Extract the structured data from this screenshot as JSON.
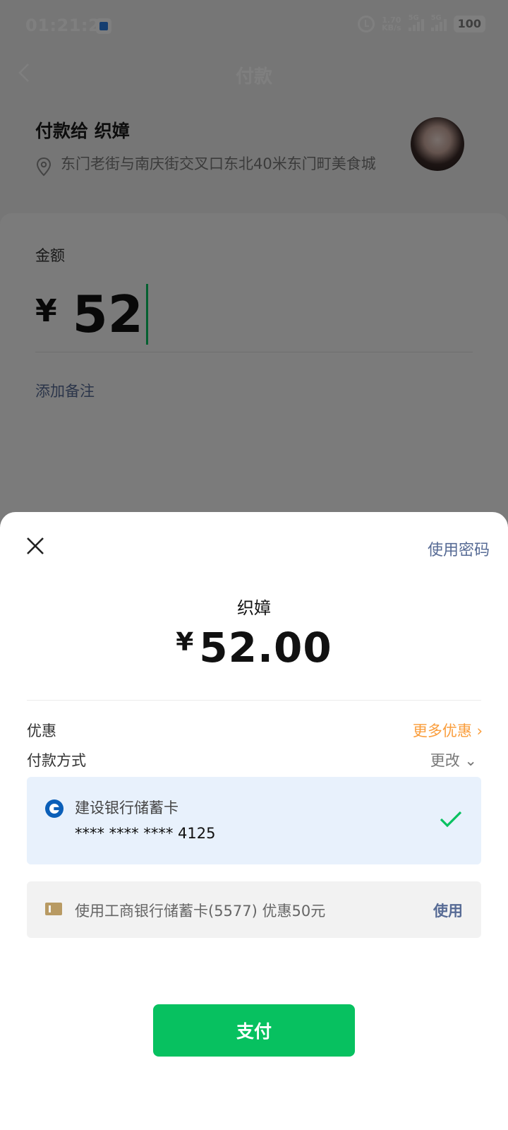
{
  "status_bar": {
    "time": "01:21:26",
    "net_speed_value": "1.70",
    "net_speed_unit": "KB/s",
    "sim1": "5G",
    "sim2": "5G",
    "battery": "100"
  },
  "nav": {
    "title": "付款"
  },
  "payee": {
    "title": "付款给 织嫜",
    "location": "东门老街与南庆街交叉口东北40米东门町美食城"
  },
  "amount": {
    "label": "金额",
    "currency": "¥",
    "value": "52"
  },
  "add_note": "添加备注",
  "sheet": {
    "use_password": "使用密码",
    "payee_name": "织嫜",
    "currency": "¥",
    "amount": "52.00",
    "promo_label": "优惠",
    "promo_link": "更多优惠 ›",
    "method_label": "付款方式",
    "change_link": "更改 ⌄",
    "selected_card": {
      "name": "建设银行储蓄卡",
      "number": "**** **** **** 4125"
    },
    "coupon": {
      "text": "使用工商银行储蓄卡(5577) 优惠50元",
      "action": "使用"
    },
    "pay_button": "支付"
  },
  "colors": {
    "accent_green": "#07c160",
    "link_blue": "#576b95",
    "promo_orange": "#fa9d3b",
    "card_bg": "#e8f1fc"
  }
}
